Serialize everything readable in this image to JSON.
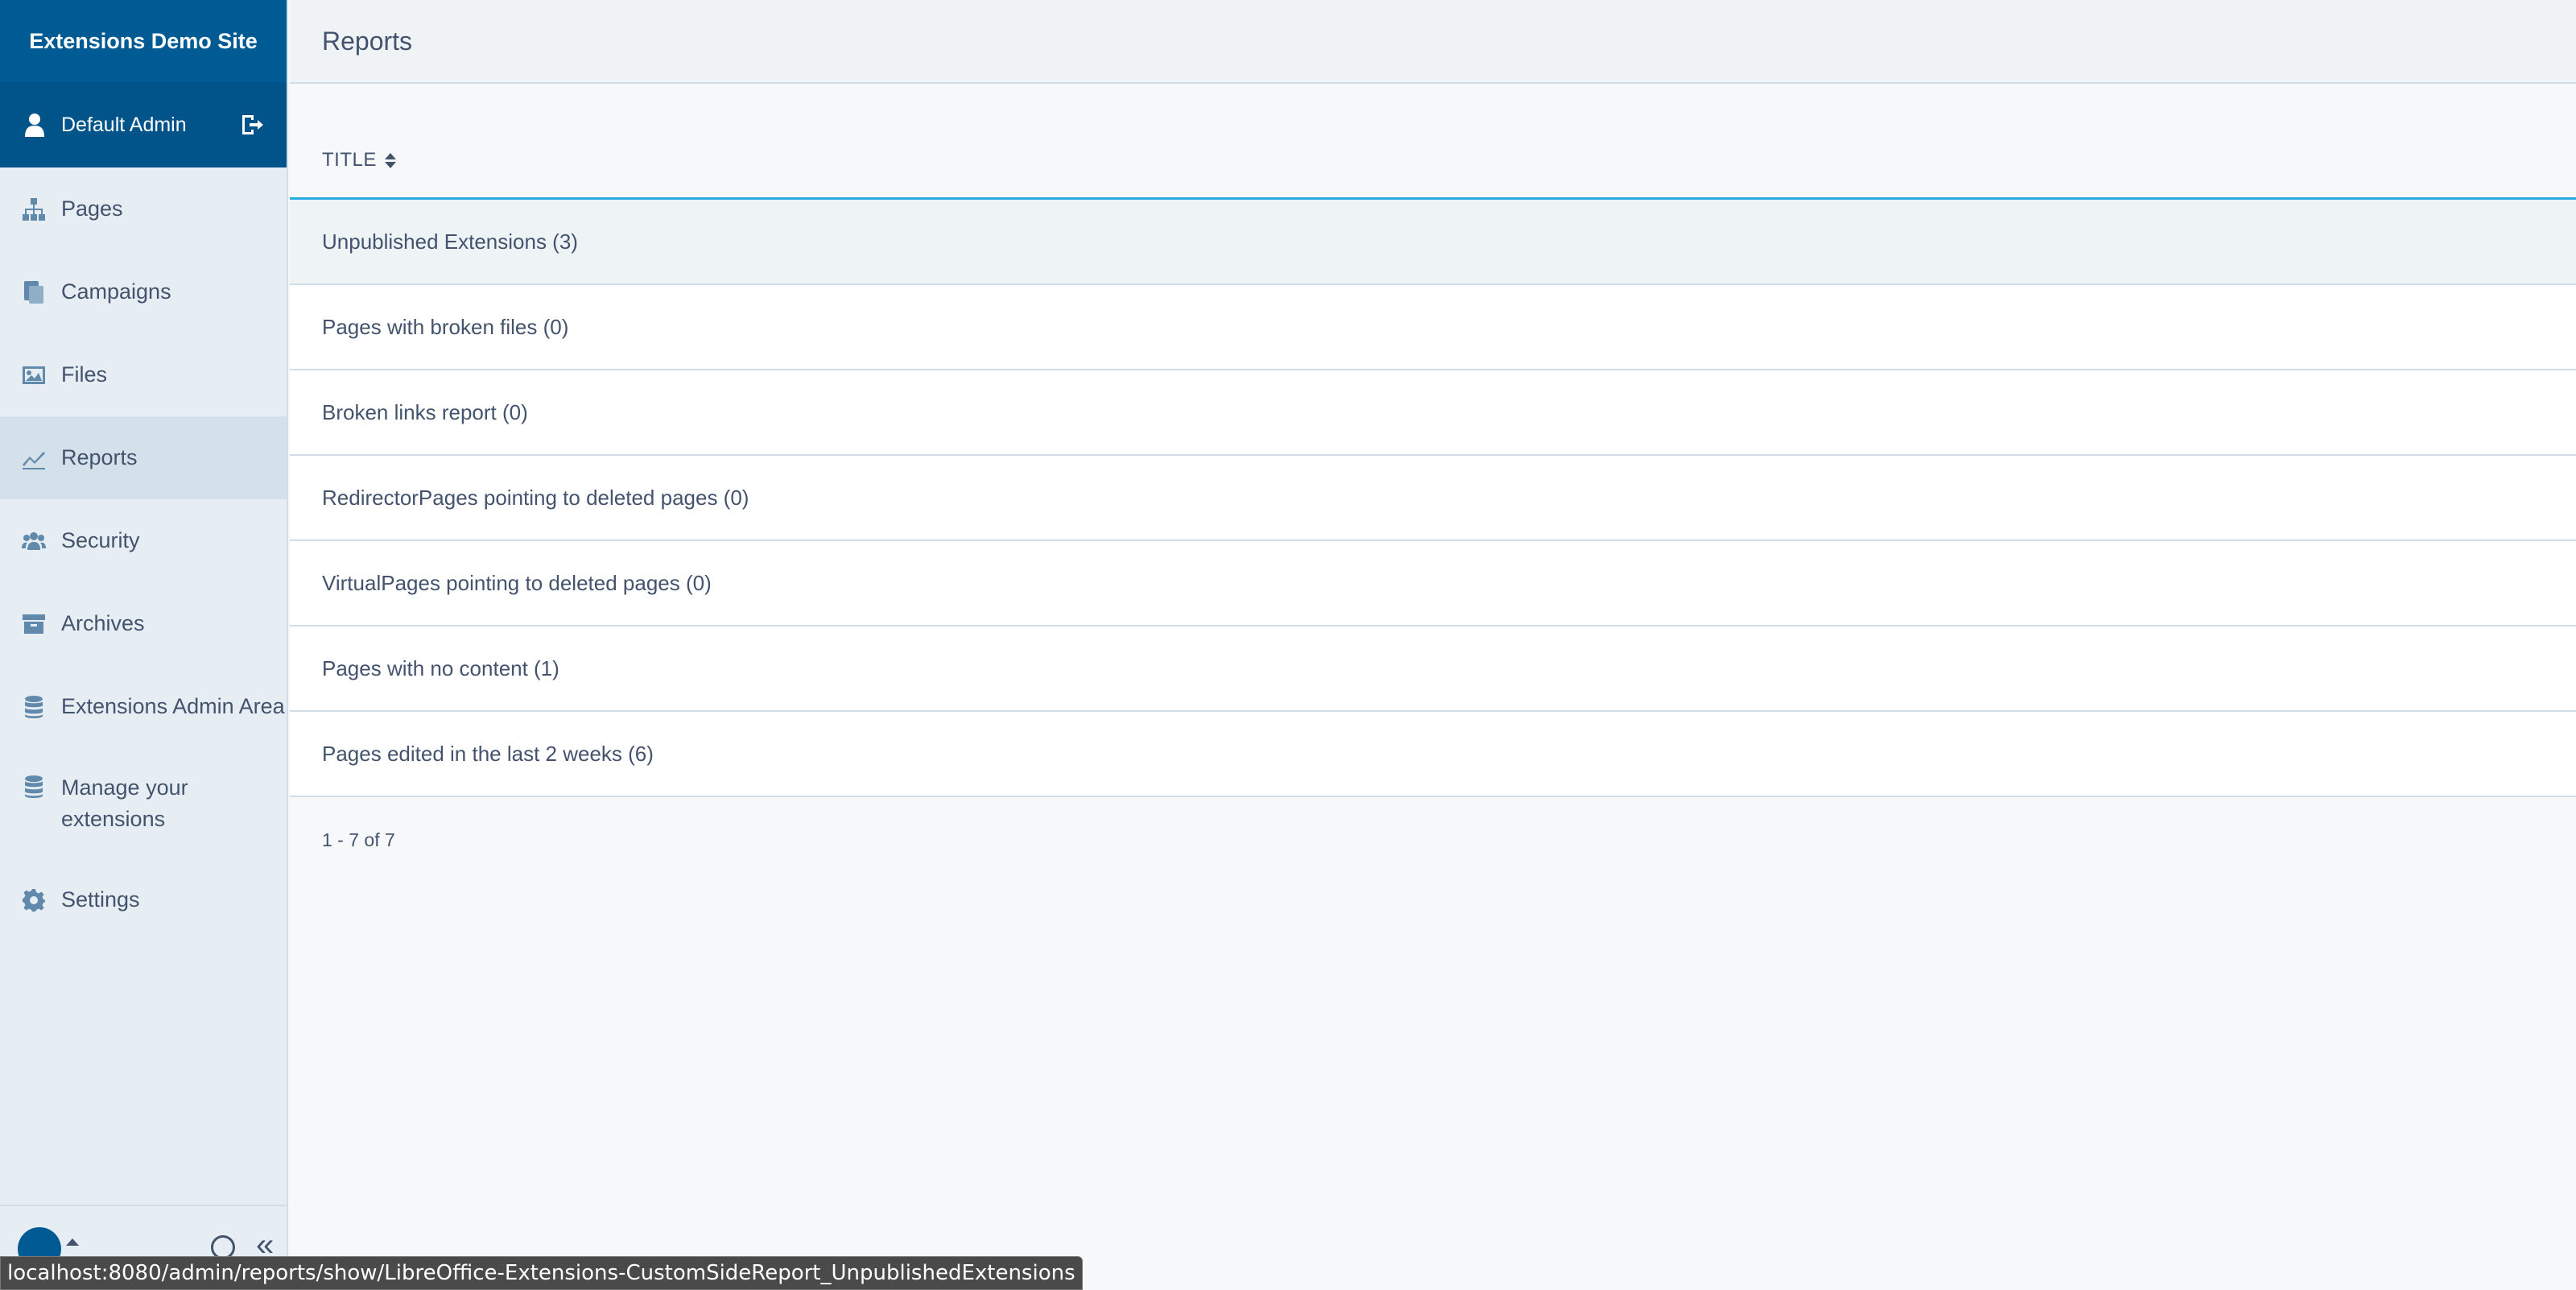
{
  "sidebar": {
    "site_title": "Extensions Demo Site",
    "user_name": "Default Admin",
    "items": [
      {
        "label": "Pages",
        "icon": "sitemap-icon"
      },
      {
        "label": "Campaigns",
        "icon": "copy-icon"
      },
      {
        "label": "Files",
        "icon": "image-icon"
      },
      {
        "label": "Reports",
        "icon": "chart-line-icon",
        "active": true
      },
      {
        "label": "Security",
        "icon": "users-icon"
      },
      {
        "label": "Archives",
        "icon": "archive-icon"
      },
      {
        "label": "Extensions Admin Area",
        "icon": "database-icon"
      },
      {
        "label": "Manage your extensions",
        "icon": "database-icon"
      },
      {
        "label": "Settings",
        "icon": "gear-icon"
      }
    ],
    "footer": {
      "collapse_glyph": "«"
    }
  },
  "header": {
    "title": "Reports"
  },
  "table": {
    "column_title": "TITLE",
    "rows": [
      "Unpublished Extensions (3)",
      "Pages with broken files (0)",
      "Broken links report (0)",
      "RedirectorPages pointing to deleted pages (0)",
      "VirtualPages pointing to deleted pages (0)",
      "Pages with no content (1)",
      "Pages edited in the last 2 weeks (6)"
    ],
    "pagination": "1 - 7 of 7"
  },
  "statusbar": {
    "url": "localhost:8080/admin/reports/show/LibreOffice-Extensions-CustomSideReport_UnpublishedExtensions"
  },
  "colors": {
    "brand": "#005b94",
    "accent": "#29abe2",
    "sidebar_bg": "#e6eef3"
  }
}
